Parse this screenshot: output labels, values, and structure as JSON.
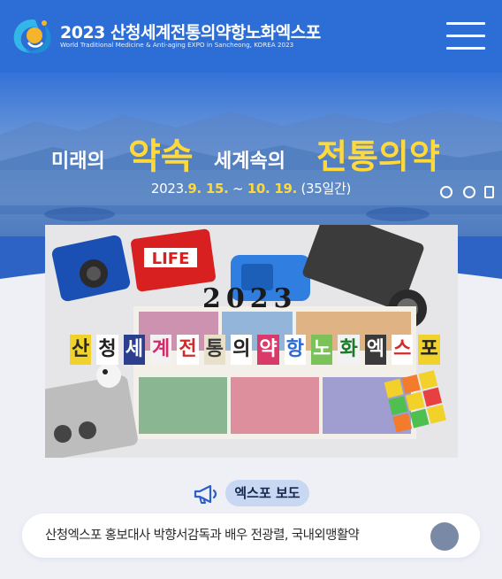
{
  "header": {
    "title": "2023 산청세계전통의약항노화엑스포",
    "subtitle": "World Traditional Medicine & Anti-aging EXPO in Sancheong, KOREA 2023"
  },
  "hero": {
    "slogan_1": "미래의",
    "slogan_2": "약속",
    "slogan_3": "세계속의",
    "slogan_4": "전통의약",
    "date_prefix": "2023.",
    "date_start": "9. 15.",
    "date_sep": " ~ ",
    "date_end": "10. 19.",
    "date_suffix": " (35일간)"
  },
  "poster": {
    "year": "2023",
    "title_chars": [
      "산",
      "청",
      "세",
      "계",
      "전",
      "통",
      "의",
      "약",
      "항",
      "노",
      "화",
      "엑",
      "스",
      "포"
    ]
  },
  "section": {
    "label": "엑스포 보도",
    "news_title": "산청엑스포 홍보대사 박향서감독과 배우 전광렬, 국내외맹활약"
  },
  "colors": {
    "brand_blue": "#2d6ed6",
    "accent_yellow": "#ffd83a",
    "pill_bg": "#c8d8f3",
    "page_bg": "#eef0f6"
  }
}
